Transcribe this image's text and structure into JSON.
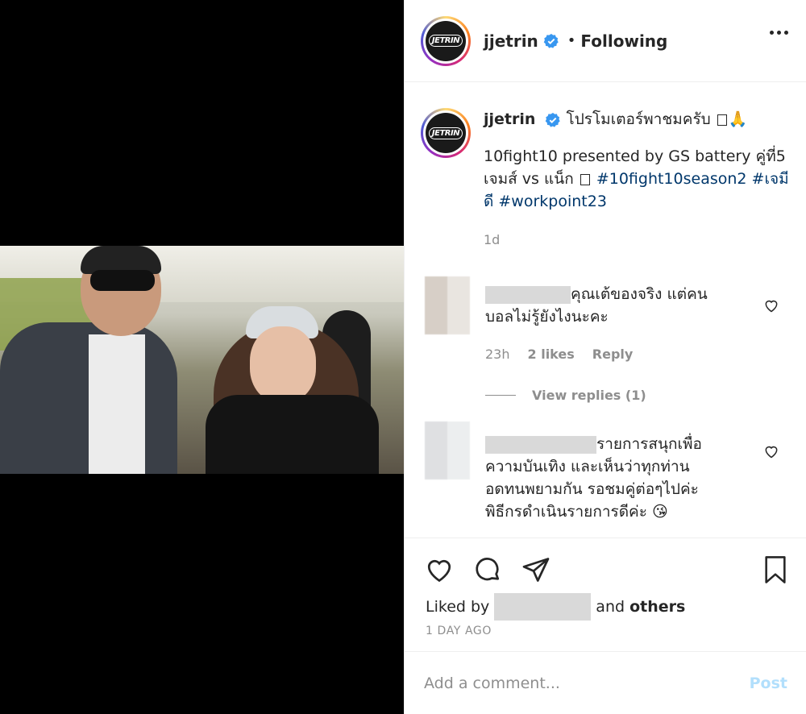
{
  "header": {
    "avatar_text": "JETRIN",
    "username": "jjetrin",
    "separator": "•",
    "follow_status": "Following"
  },
  "caption": {
    "avatar_text": "JETRIN",
    "username": "jjetrin",
    "line1": "โปรโมเตอร์พาชมครับ",
    "line1_emoji": "🙏",
    "text_a": "10fight10 presented by GS battery คู่ที่5 เจมส์ vs แน็ก",
    "hashtags": [
      "#10fight10season2",
      "#เจมีดี",
      "#workpoint23"
    ],
    "time": "1d"
  },
  "comments": [
    {
      "text": "คุณเต้ของจริง แต่คนบอลไม่รู้ยังไงนะคะ",
      "time": "23h",
      "likes": "2 likes",
      "reply": "Reply",
      "view_replies": "View replies (1)"
    },
    {
      "text": "รายการสนุกเพื่อความบันเทิง และเห็นว่าทุกท่านอดทนพยามกัน รอชมคู่ต่อๆไปค่ะ พิธีกรดำเนินรายการดีค่ะ",
      "emoji": "😘"
    }
  ],
  "likes": {
    "prefix": "Liked by",
    "and": "and",
    "others": "others"
  },
  "date": "1 DAY AGO",
  "add_comment": {
    "placeholder": "Add a comment...",
    "post_label": "Post"
  },
  "colors": {
    "hashtag": "#00376b",
    "verified": "#3897f0",
    "post_disabled": "#b2dffc",
    "meta_gray": "#8e8e8e"
  },
  "icons": [
    "verified-icon",
    "more-icon",
    "heart-icon",
    "comment-icon",
    "share-icon",
    "bookmark-icon"
  ]
}
